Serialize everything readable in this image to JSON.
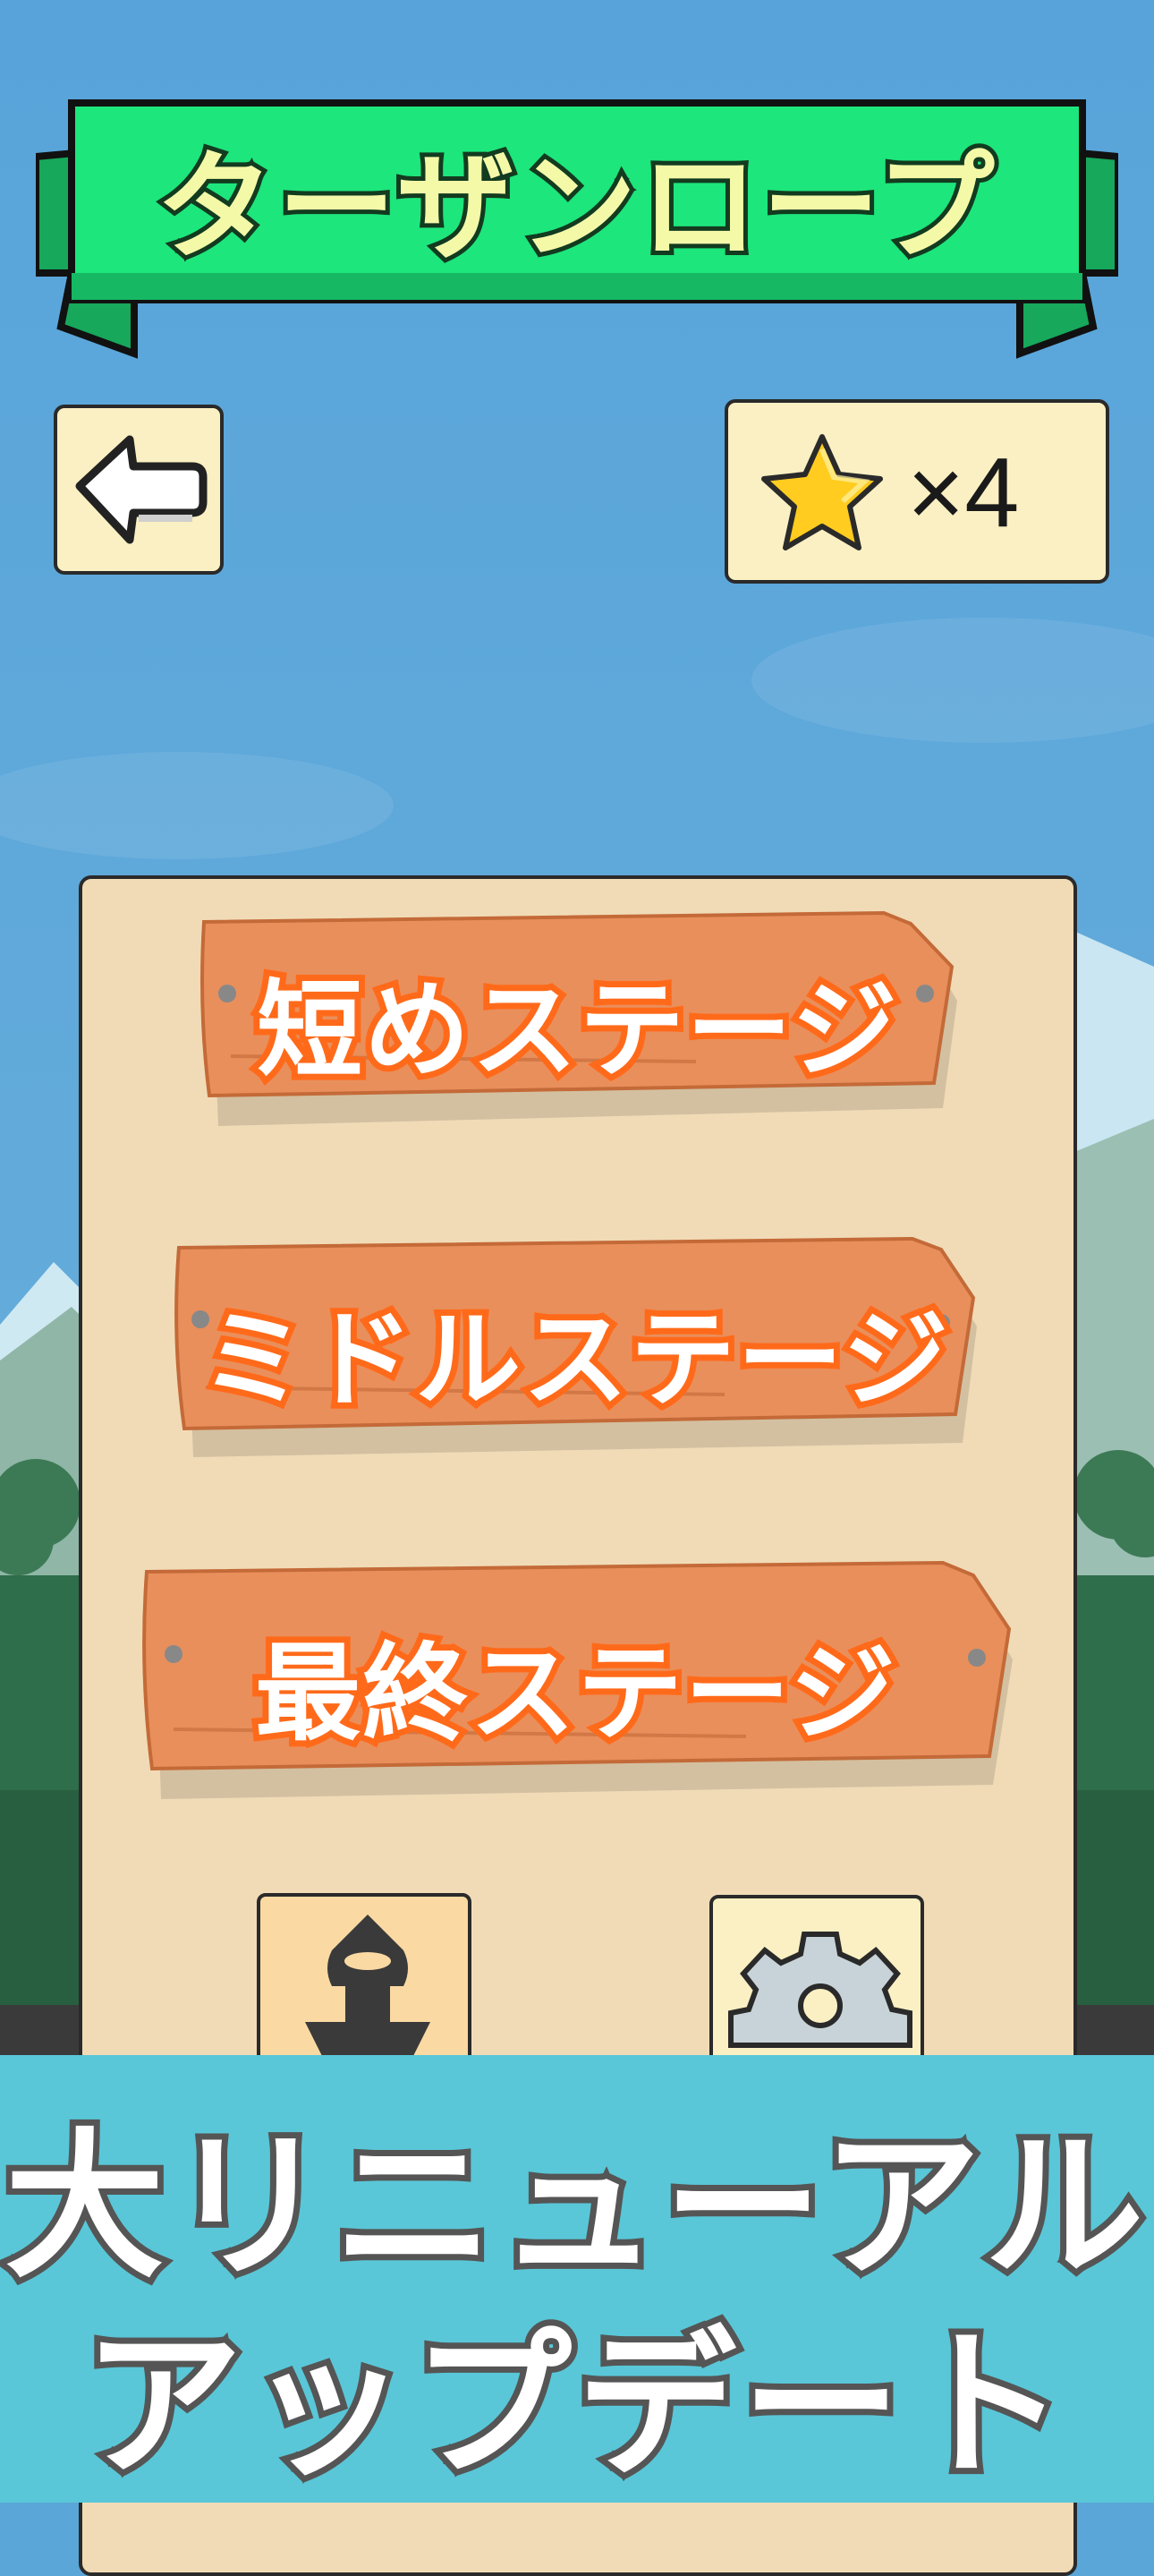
{
  "game": {
    "title": "ターザンロープ",
    "star_count": "×4"
  },
  "menu": {
    "buttons": [
      {
        "label": "短めステージ"
      },
      {
        "label": "ミドルステージ"
      },
      {
        "label": "最終ステージ"
      }
    ],
    "icons": [
      "ninja-icon",
      "gear-icon",
      "back-arrow-icon",
      "star-icon"
    ]
  },
  "banner": {
    "line1": "大リニューアル",
    "line2": "アップデート"
  },
  "colors": {
    "sky": "#5aa6d8",
    "ribbon": "#1ee27c",
    "panel": "#f1dbb7",
    "plank": "#e98f5c",
    "plank_text_outline": "#ff6a1a",
    "banner": "#59c7d8"
  }
}
